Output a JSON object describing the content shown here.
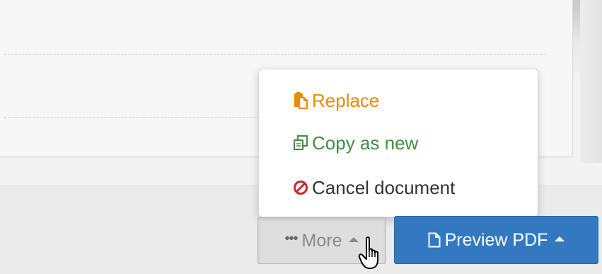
{
  "dropdown": {
    "items": [
      {
        "label": "Replace",
        "icon": "paste-icon",
        "color": "#e88b00"
      },
      {
        "label": "Copy as new",
        "icon": "copy-icon",
        "color": "#3f8f3f"
      },
      {
        "label": "Cancel document",
        "icon": "ban-icon",
        "color": "#c62828"
      }
    ]
  },
  "toolbar": {
    "more_label": "More",
    "preview_label": "Preview PDF"
  },
  "colors": {
    "primary": "#3379c1",
    "warning": "#e88b00",
    "success": "#3f8f3f",
    "danger": "#c62828"
  }
}
